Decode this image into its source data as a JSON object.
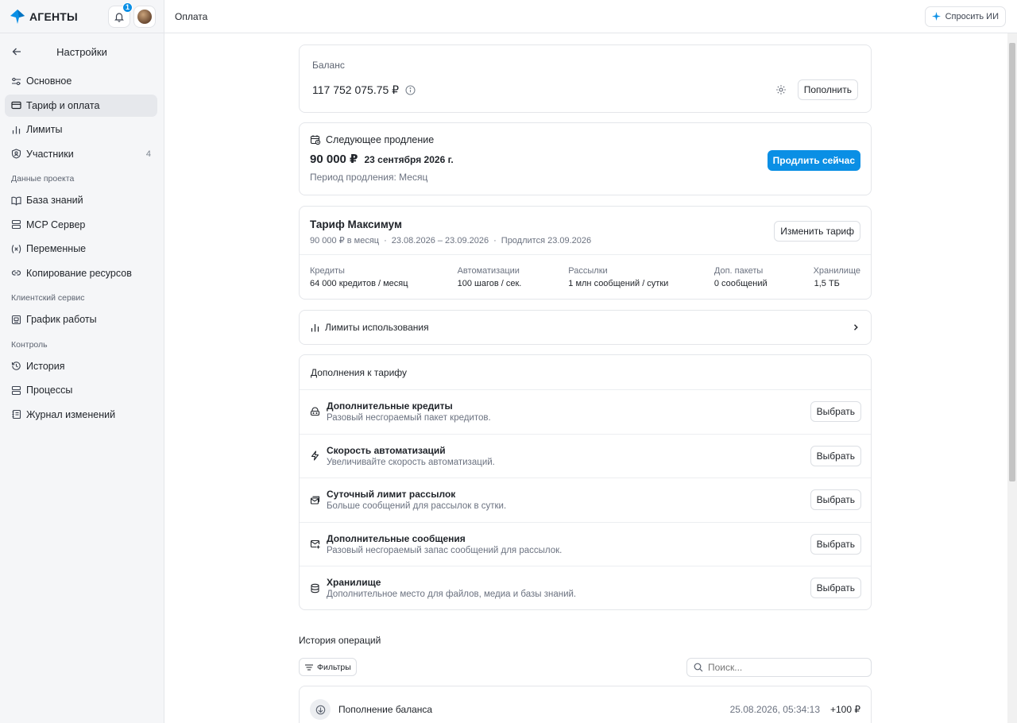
{
  "app": {
    "brand": "АГЕНТЫ",
    "notifications_count": "1",
    "accent": "#0a8fe5"
  },
  "topbar": {
    "title": "Оплата",
    "ask_ai": "Спросить ИИ"
  },
  "sidebar": {
    "header": "Настройки",
    "items_main": [
      {
        "label": "Основное",
        "icon": "sliders-icon"
      },
      {
        "label": "Тариф и оплата",
        "icon": "card-icon",
        "active": true
      },
      {
        "label": "Лимиты",
        "icon": "bar-chart-icon"
      },
      {
        "label": "Участники",
        "icon": "shield-icon",
        "count": "4"
      }
    ],
    "section_project": "Данные проекта",
    "items_project": [
      {
        "label": "База знаний",
        "icon": "book-icon"
      },
      {
        "label": "MCP Сервер",
        "icon": "server-icon"
      },
      {
        "label": "Переменные",
        "icon": "variable-icon"
      },
      {
        "label": "Копирование ресурсов",
        "icon": "link-icon"
      }
    ],
    "section_client": "Клиентский сервис",
    "items_client": [
      {
        "label": "График работы",
        "icon": "calendar-icon"
      }
    ],
    "section_control": "Контроль",
    "items_control": [
      {
        "label": "История",
        "icon": "history-icon"
      },
      {
        "label": "Процессы",
        "icon": "server-icon"
      },
      {
        "label": "Журнал изменений",
        "icon": "journal-icon"
      }
    ]
  },
  "balance": {
    "label": "Баланс",
    "amount": "117 752 075.75 ₽",
    "topup": "Пополнить"
  },
  "renewal": {
    "title": "Следующее продление",
    "amount": "90 000 ₽",
    "date": "23 сентября 2026 г.",
    "period": "Период продления: Месяц",
    "renew_now": "Продлить сейчас"
  },
  "plan": {
    "title": "Тариф Максимум",
    "price": "90 000 ₽ в месяц",
    "range": "23.08.2026 – 23.09.2026",
    "extends": "Продлится 23.09.2026",
    "change": "Изменить тариф",
    "stats": [
      {
        "k": "Кредиты",
        "v": "64 000 кредитов / месяц"
      },
      {
        "k": "Автоматизации",
        "v": "100 шагов / сек."
      },
      {
        "k": "Рассылки",
        "v": "1 млн сообщений / сутки"
      },
      {
        "k": "Доп. пакеты",
        "v": "0 сообщений"
      },
      {
        "k": "Хранилище",
        "v": "1,5 ТБ"
      }
    ]
  },
  "limits": {
    "label": "Лимиты использования"
  },
  "addons": {
    "title": "Дополнения к тарифу",
    "select": "Выбрать",
    "items": [
      {
        "title": "Дополнительные кредиты",
        "desc": "Разовый несгораемый пакет кредитов.",
        "icon": "coins-icon"
      },
      {
        "title": "Скорость автоматизаций",
        "desc": "Увеличивайте скорость автоматизаций.",
        "icon": "lightning-icon"
      },
      {
        "title": "Суточный лимит рассылок",
        "desc": "Больше сообщений для рассылок в сутки.",
        "icon": "mail-stack-icon"
      },
      {
        "title": "Дополнительные сообщения",
        "desc": "Разовый несгораемый запас сообщений для рассылок.",
        "icon": "mail-plus-icon"
      },
      {
        "title": "Хранилище",
        "desc": "Дополнительное место для файлов, медиа и базы знаний.",
        "icon": "database-icon"
      }
    ]
  },
  "history": {
    "title": "История операций",
    "filters": "Фильтры",
    "search_placeholder": "Поиск...",
    "rows": [
      {
        "title": "Пополнение баланса",
        "date": "25.08.2026, 05:34:13",
        "amount": "+100 ₽"
      }
    ]
  }
}
